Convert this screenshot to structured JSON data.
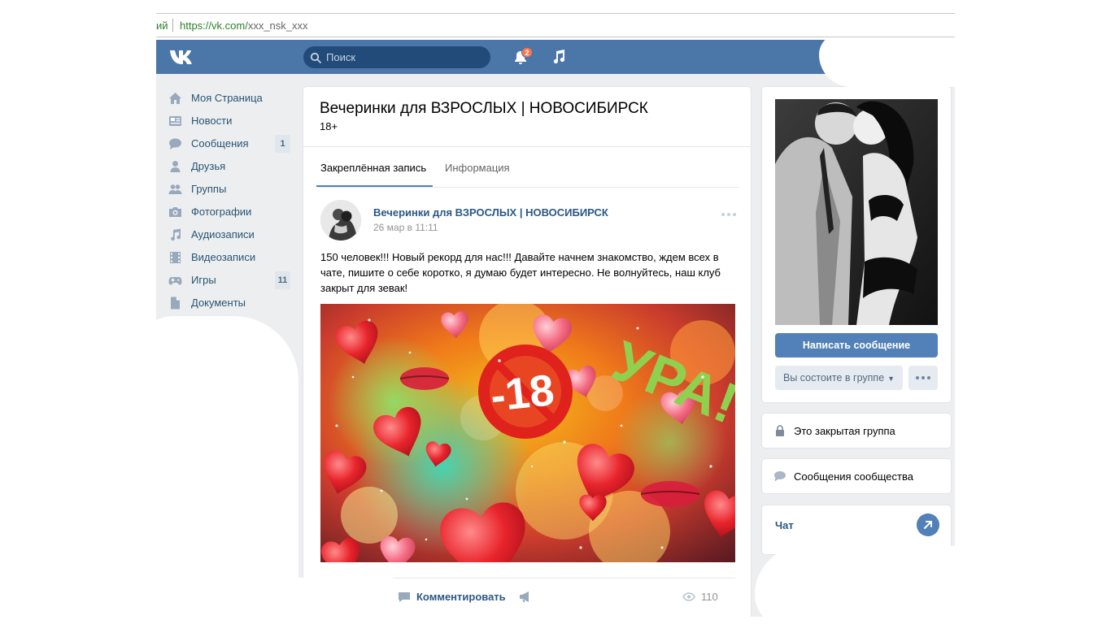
{
  "browser": {
    "prev_tab_fragment": "ий",
    "url_host": "https://vk.com/",
    "url_path": "xxx_nsk_xxx"
  },
  "header": {
    "logo_icon": "vk-logo-icon",
    "search_placeholder": "Поиск",
    "notifications_count": "2",
    "music_icon": "music-note-icon",
    "accent_color": "#4a76a8"
  },
  "sidebar": {
    "items": [
      {
        "label": "Моя Страница",
        "icon": "home-icon",
        "count": ""
      },
      {
        "label": "Новости",
        "icon": "news-icon",
        "count": ""
      },
      {
        "label": "Сообщения",
        "icon": "messages-icon",
        "count": "1"
      },
      {
        "label": "Друзья",
        "icon": "friend-icon",
        "count": ""
      },
      {
        "label": "Группы",
        "icon": "groups-icon",
        "count": ""
      },
      {
        "label": "Фотографии",
        "icon": "camera-icon",
        "count": ""
      },
      {
        "label": "Аудиозаписи",
        "icon": "music-icon",
        "count": ""
      },
      {
        "label": "Видеозаписи",
        "icon": "film-icon",
        "count": ""
      },
      {
        "label": "Игры",
        "icon": "gamepad-icon",
        "count": "11"
      },
      {
        "label": "Документы",
        "icon": "document-icon",
        "count": ""
      }
    ]
  },
  "group": {
    "title": "Вечеринки для ВЗРОСЛЫХ | НОВОСИБИРСК",
    "status": "18+"
  },
  "tabs": {
    "pinned": "Закреплённая запись",
    "info": "Информация"
  },
  "post": {
    "author": "Вечеринки для ВЗРОСЛЫХ | НОВОСИБИРСК",
    "date": "26 мар в 11:11",
    "text": "150 человек!!! Новый рекорд для нас!!! Давайте начнем знакомство, ждем всех в чате, пишите о себе коротко, я думаю будет интересно. Не волнуйтесь, наш клуб закрыт для зевак!",
    "image": {
      "badge_text": "-18",
      "headline": "УРА!"
    },
    "comment_label": "Комментировать",
    "views": "110"
  },
  "side": {
    "write_button": "Написать сообщение",
    "member_button": "Вы состоите в группе",
    "closed_group": "Это закрытая группа",
    "community_messages": "Сообщения сообщества",
    "chat": "Чат"
  }
}
